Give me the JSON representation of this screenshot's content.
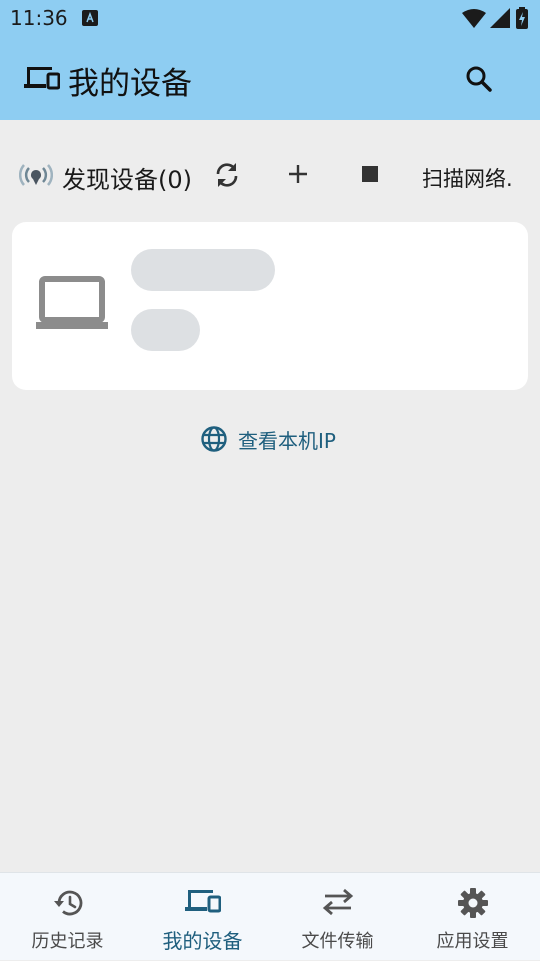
{
  "status_bar": {
    "time": "11:36"
  },
  "app_bar": {
    "title": "我的设备"
  },
  "toolbar": {
    "discover_label": "发现设备(0)",
    "scan_label": "扫描网络."
  },
  "link": {
    "view_ip": "查看本机IP"
  },
  "bottom_nav": {
    "items": [
      {
        "label": "历史记录",
        "icon": "history-icon"
      },
      {
        "label": "我的设备",
        "icon": "devices-icon"
      },
      {
        "label": "文件传输",
        "icon": "swap-icon"
      },
      {
        "label": "应用设置",
        "icon": "gear-icon"
      }
    ],
    "active_index": 1
  },
  "colors": {
    "app_bar": "#8ecdf2",
    "accent": "#1f5f7e",
    "background": "#ededed",
    "card": "#ffffff",
    "skeleton": "#dde0e3"
  }
}
